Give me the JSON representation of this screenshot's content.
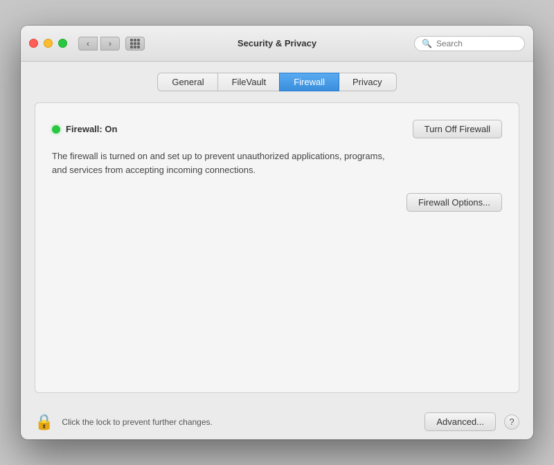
{
  "window": {
    "title": "Security & Privacy"
  },
  "titlebar": {
    "traffic_lights": {
      "close_label": "",
      "minimize_label": "",
      "maximize_label": ""
    },
    "nav_back_label": "‹",
    "nav_forward_label": "›",
    "search_placeholder": "Search"
  },
  "tabs": [
    {
      "id": "general",
      "label": "General",
      "active": false
    },
    {
      "id": "filevault",
      "label": "FileVault",
      "active": false
    },
    {
      "id": "firewall",
      "label": "Firewall",
      "active": true
    },
    {
      "id": "privacy",
      "label": "Privacy",
      "active": false
    }
  ],
  "firewall": {
    "status_dot_color": "#28c840",
    "status_label": "Firewall: On",
    "turn_off_button": "Turn Off Firewall",
    "description": "The firewall is turned on and set up to prevent unauthorized applications, programs, and services from accepting incoming connections.",
    "options_button": "Firewall Options..."
  },
  "bottombar": {
    "lock_icon": "🔒",
    "lock_text": "Click the lock to prevent further changes.",
    "advanced_button": "Advanced...",
    "help_button": "?"
  }
}
